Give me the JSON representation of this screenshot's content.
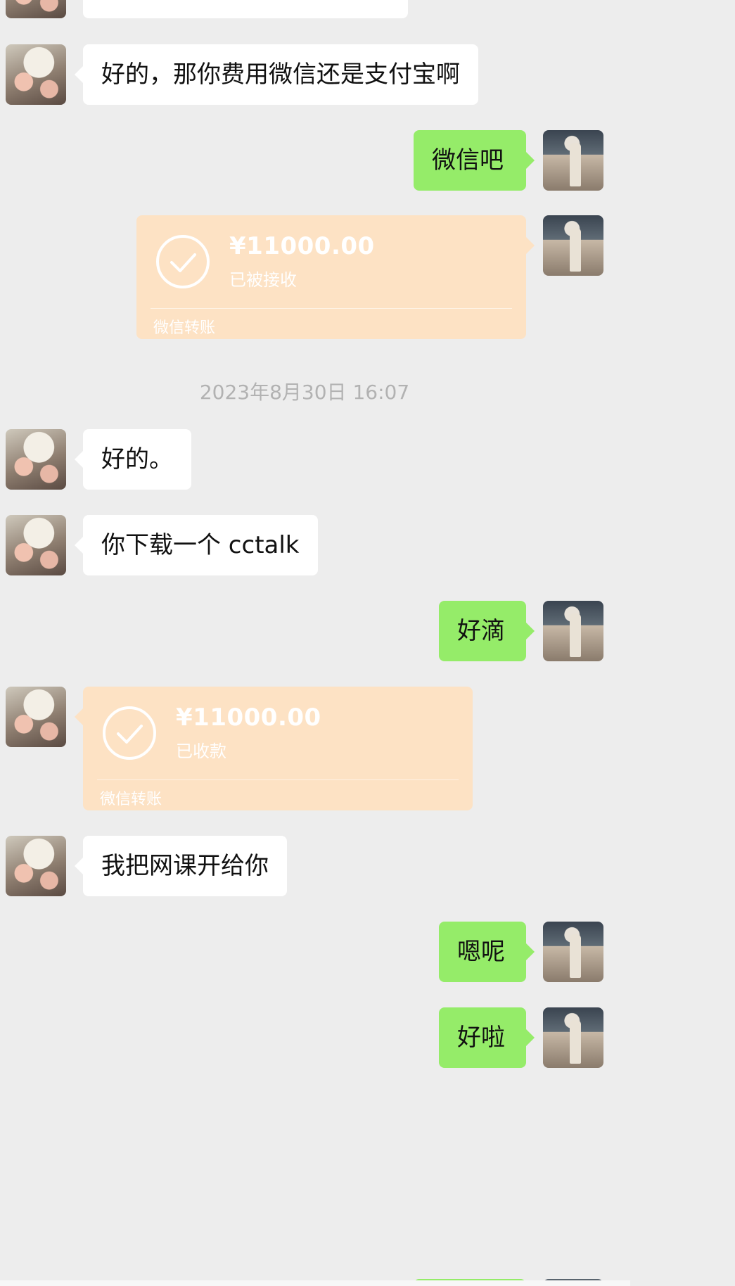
{
  "messages": {
    "m0_partial": "",
    "m1": "好的，那你费用微信还是支付宝啊",
    "m2": "微信吧",
    "t1": {
      "amount": "¥11000.00",
      "status": "已被接收",
      "kind": "微信转账"
    },
    "timestamp": "2023年8月30日 16:07",
    "m3": "好的。",
    "m4": "你下载一个 cctalk",
    "m5": "好滴",
    "t2": {
      "amount": "¥11000.00",
      "status": "已收款",
      "kind": "微信转账"
    },
    "m6": "我把网课开给你",
    "m7": "嗯呢",
    "m8": "好啦"
  },
  "colors": {
    "chat_bg": "#ededed",
    "incoming_bubble": "#ffffff",
    "outgoing_bubble": "#95ec69",
    "transfer_card": "#fde2c4"
  }
}
